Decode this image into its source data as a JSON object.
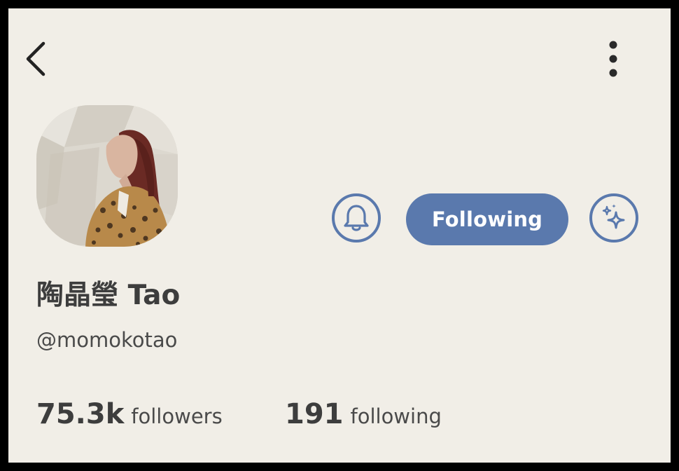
{
  "icons": {
    "back": "back-arrow-icon",
    "more": "more-vertical-icon",
    "notify": "bell-icon",
    "ai": "sparkle-icon"
  },
  "colors": {
    "accent": "#5a79ad",
    "background": "#f1eee7",
    "text": "#3d3d3d"
  },
  "profile": {
    "display_name": "陶晶瑩 Tao",
    "handle": "@momokotao",
    "follow_button_label": "Following"
  },
  "stats": {
    "followers_count": "75.3k",
    "followers_label": "followers",
    "following_count": "191",
    "following_label": "following"
  }
}
